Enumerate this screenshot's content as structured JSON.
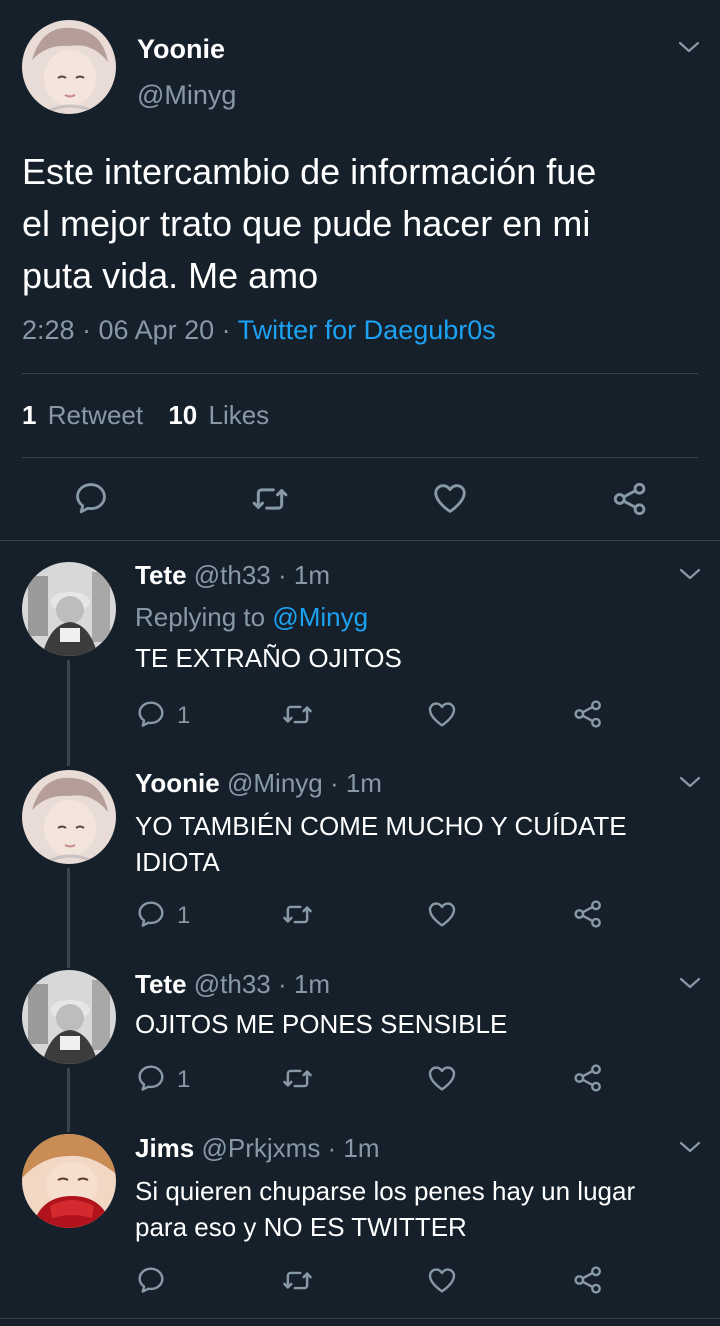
{
  "main_tweet": {
    "name": "Yoonie",
    "handle": "@Minyg",
    "text_line1": "Este intercambio de información fue",
    "text_line2": "el mejor trato que pude hacer en mi",
    "text_line3": "puta vida. Me amo",
    "time": "2:28 · 06 Apr 20 · ",
    "source": "Twitter for Daegubr0s",
    "retweets_count": "1",
    "retweets_label": "Retweet",
    "likes_count": "10",
    "likes_label": "Likes"
  },
  "replies": [
    {
      "name": "Tete",
      "meta": "@th33 · 1m",
      "replying_prefix": "Replying to ",
      "replying_handle": "@Minyg",
      "line1": "TE EXTRAÑO OJITOS",
      "reply_count": "1"
    },
    {
      "name": "Yoonie",
      "meta": "@Minyg · 1m",
      "line1": "YO TAMBIÉN COME MUCHO Y CUÍDATE",
      "line2": "IDIOTA",
      "reply_count": "1"
    },
    {
      "name": "Tete",
      "meta": "@th33 · 1m",
      "line1": "OJITOS ME PONES SENSIBLE",
      "reply_count": "1"
    },
    {
      "name": "Jims",
      "meta": "@Prkjxms · 1m",
      "line1": "Si quieren chuparse los penes hay un lugar",
      "line2": "para eso y NO ES TWITTER"
    }
  ],
  "colors": {
    "background": "#15202b",
    "text": "#ffffff",
    "secondary": "#8899a6",
    "accent": "#1da1f2",
    "divider": "#38444d"
  },
  "icons": [
    "reply-icon",
    "retweet-icon",
    "like-icon",
    "share-icon",
    "chevron-down-icon",
    "avatar"
  ]
}
